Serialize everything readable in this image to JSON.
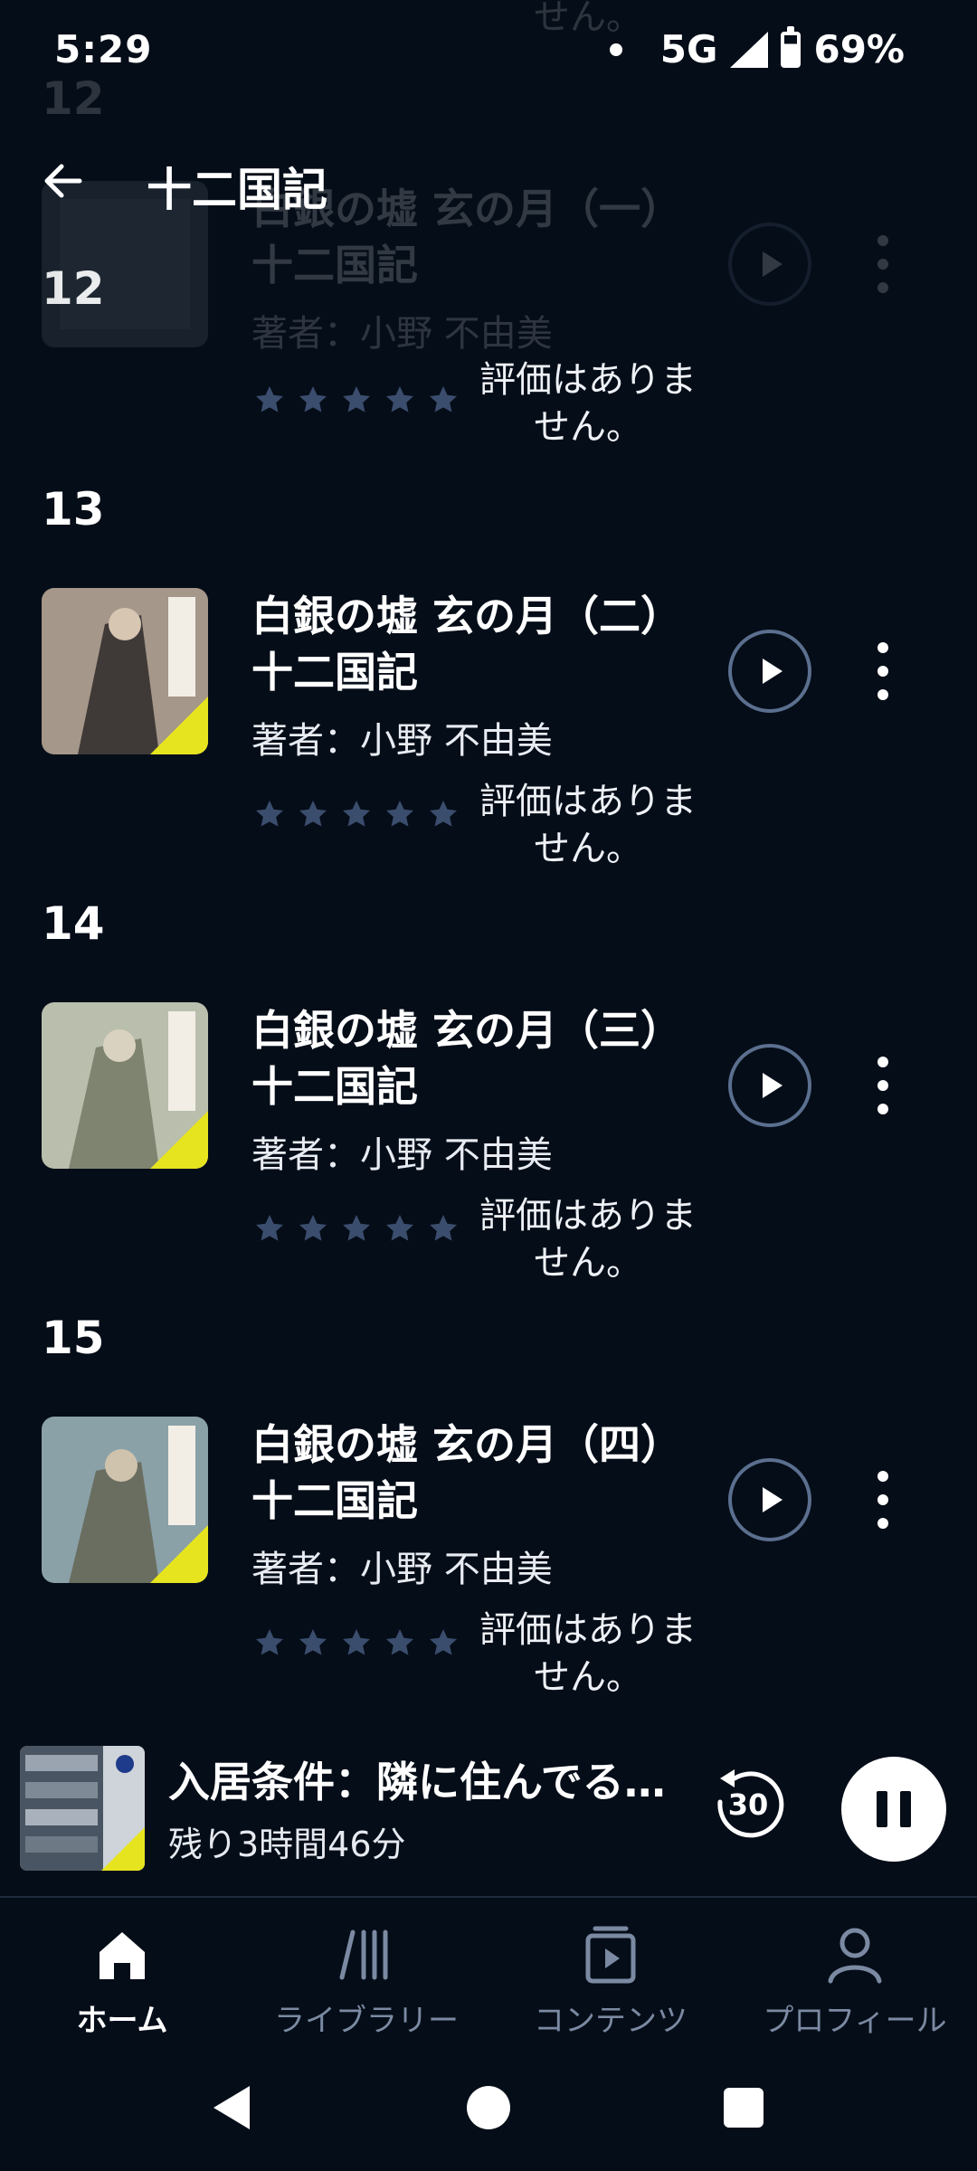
{
  "status": {
    "time": "5:29",
    "network": "5G",
    "battery": "69%"
  },
  "ghost": {
    "rank": "12",
    "text": "せん。"
  },
  "appbar": {
    "title": "十二国記"
  },
  "items": [
    {
      "rank": "12",
      "title_line1": "白銀の墟 玄の月（一）",
      "title_line2": "十二国記",
      "author": "著者：小野 不由美",
      "rating": "評価はありま せん。"
    },
    {
      "rank": "13",
      "title_line1": "白銀の墟 玄の月（二）",
      "title_line2": "十二国記",
      "author": "著者：小野 不由美",
      "rating": "評価はありま せん。"
    },
    {
      "rank": "14",
      "title_line1": "白銀の墟 玄の月（三）",
      "title_line2": "十二国記",
      "author": "著者：小野 不由美",
      "rating": "評価はありま せん。"
    },
    {
      "rank": "15",
      "title_line1": "白銀の墟 玄の月（四）",
      "title_line2": "十二国記",
      "author": "著者：小野 不由美",
      "rating": "評価はありま せん。"
    }
  ],
  "miniplayer": {
    "title": "入居条件：隣に住んでる…",
    "remaining": "残り3時間46分",
    "replay": "30"
  },
  "nav": [
    {
      "label": "ホーム",
      "icon": "home-icon",
      "active": true
    },
    {
      "label": "ライブラリー",
      "icon": "library-icon"
    },
    {
      "label": "コンテンツ",
      "icon": "content-icon"
    },
    {
      "label": "プロフィール",
      "icon": "profile-icon"
    }
  ],
  "colors": {
    "background": "#050d18",
    "star": "#3b4d6d",
    "ring": "#5b6f8f",
    "inactive": "#7b8aa2"
  }
}
